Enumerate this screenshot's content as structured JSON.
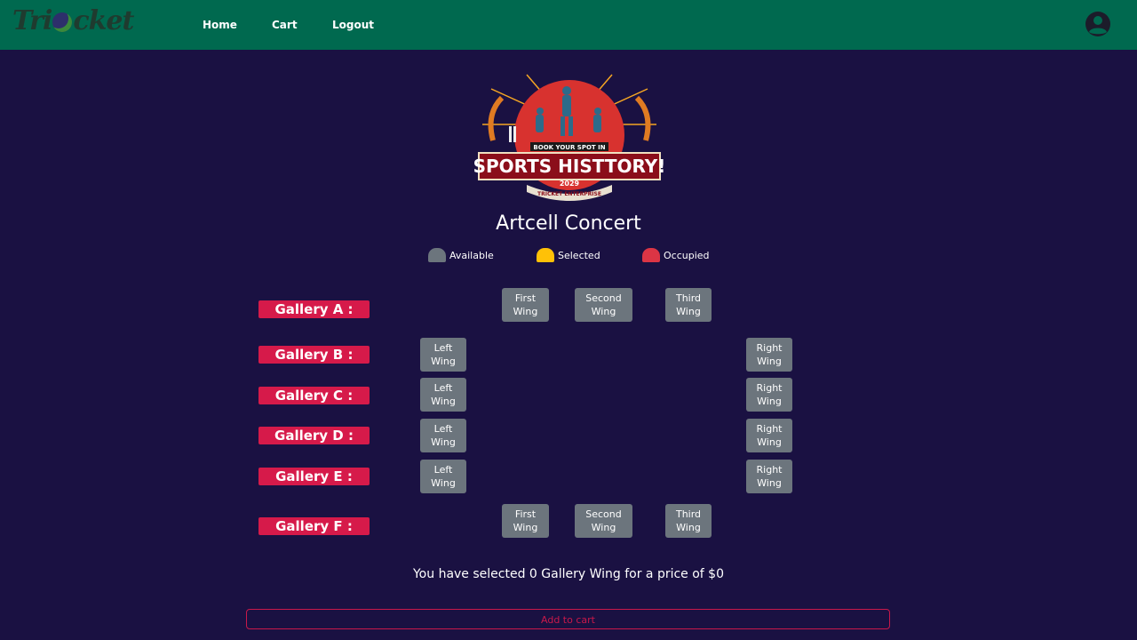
{
  "brand": {
    "part1": "Tri",
    "part2": "cket"
  },
  "nav": {
    "home": "Home",
    "cart": "Cart",
    "logout": "Logout"
  },
  "poster": {
    "top_text": "BOOK YOUR SPOT IN",
    "headline": "SPORTS HISTTORY!",
    "year": "2029",
    "ribbon": "TRICKET ENTERPRISE"
  },
  "event": {
    "title": "Artcell Concert"
  },
  "legend": {
    "available": "Available",
    "selected": "Selected",
    "occupied": "Occupied"
  },
  "colors": {
    "available": "#6c757d",
    "selected": "#ffc107",
    "occupied": "#dc3545",
    "gallery_label": "#d61a4a",
    "navbar": "#00694f",
    "background": "#1a1142"
  },
  "galleries": {
    "a": {
      "label": "Gallery A :",
      "first": [
        "First",
        "Wing"
      ],
      "second": [
        "Second",
        "Wing"
      ],
      "third": [
        "Third",
        "Wing"
      ]
    },
    "b": {
      "label": "Gallery B :",
      "left": [
        "Left",
        "Wing"
      ],
      "right": [
        "Right",
        "Wing"
      ]
    },
    "c": {
      "label": "Gallery C :",
      "left": [
        "Left",
        "Wing"
      ],
      "right": [
        "Right",
        "Wing"
      ]
    },
    "d": {
      "label": "Gallery D :",
      "left": [
        "Left",
        "Wing"
      ],
      "right": [
        "Right",
        "Wing"
      ]
    },
    "e": {
      "label": "Gallery E :",
      "left": [
        "Left",
        "Wing"
      ],
      "right": [
        "Right",
        "Wing"
      ]
    },
    "f": {
      "label": "Gallery F :",
      "first": [
        "First",
        "Wing"
      ],
      "second": [
        "Second",
        "Wing"
      ],
      "third": [
        "Third",
        "Wing"
      ]
    }
  },
  "summary": "You have selected 0 Gallery Wing for a price of $0",
  "cart_button": "Add to cart"
}
